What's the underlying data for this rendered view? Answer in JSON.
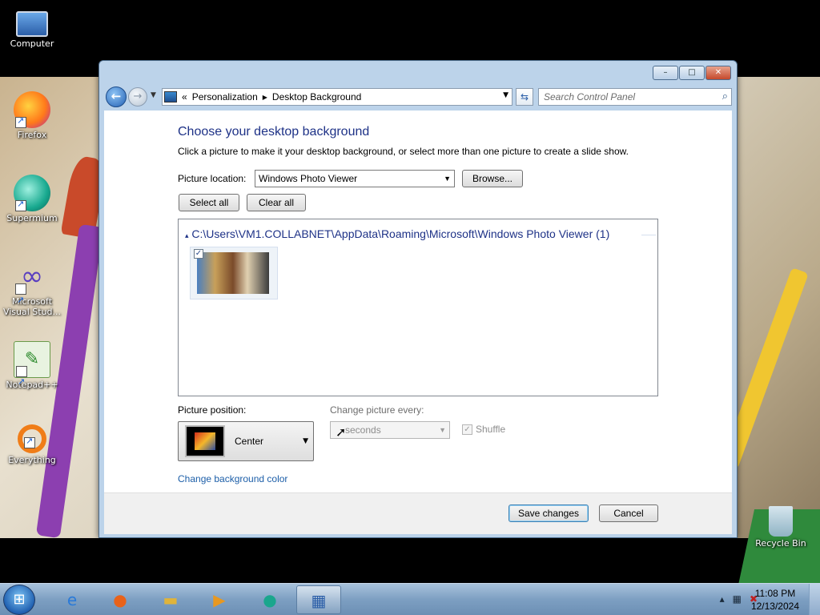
{
  "desktop": {
    "icons": [
      {
        "label": "Computer",
        "icon": "computer-icon"
      },
      {
        "label": "Firefox",
        "icon": "firefox-icon"
      },
      {
        "label": "Supermium",
        "icon": "supermium-icon"
      },
      {
        "label": "Microsoft Visual Stud...",
        "icon": "visual-studio-icon"
      },
      {
        "label": "Notepad++",
        "icon": "notepad-plus-plus-icon"
      },
      {
        "label": "Everything",
        "icon": "everything-icon"
      },
      {
        "label": "Recycle Bin",
        "icon": "recycle-bin-icon"
      }
    ]
  },
  "window": {
    "breadcrumb": [
      "Personalization",
      "Desktop Background"
    ],
    "breadcrumb_prefix": "«",
    "search_placeholder": "Search Control Panel",
    "controls": {
      "minimize": "–",
      "maximize": "□",
      "close": "✕"
    }
  },
  "page": {
    "title": "Choose your desktop background",
    "description": "Click a picture to make it your desktop background, or select more than one picture to create a slide show.",
    "picture_location_label": "Picture location:",
    "picture_location_value": "Windows Photo Viewer",
    "browse_label": "Browse...",
    "select_all_label": "Select all",
    "clear_all_label": "Clear all",
    "group_header": "C:\\Users\\VM1.COLLABNET\\AppData\\Roaming\\Microsoft\\Windows Photo Viewer (1)",
    "thumbnail_checked": true,
    "picture_position_label": "Picture position:",
    "picture_position_value": "Center",
    "change_picture_label": "Change picture every:",
    "change_picture_value": "seconds",
    "shuffle_label": "Shuffle",
    "shuffle_checked": true,
    "change_color_link": "Change background color"
  },
  "footer": {
    "save_label": "Save changes",
    "cancel_label": "Cancel"
  },
  "taskbar": {
    "pinned": [
      "internet-explorer-icon",
      "firefox-icon",
      "file-explorer-icon",
      "media-player-icon",
      "supermium-icon",
      "control-panel-icon"
    ],
    "time": "11:08 PM",
    "date": "12/13/2024"
  }
}
